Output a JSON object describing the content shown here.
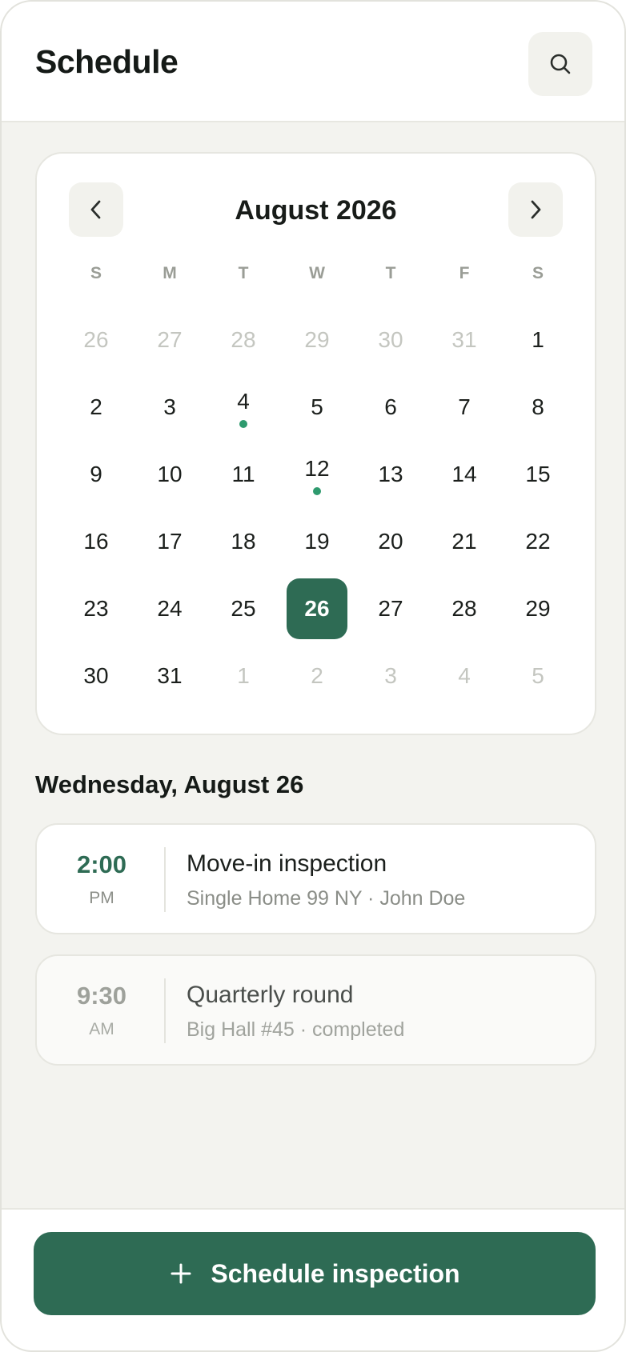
{
  "header": {
    "title": "Schedule"
  },
  "calendar": {
    "month": "August 2026",
    "weekdays": [
      "S",
      "M",
      "T",
      "W",
      "T",
      "F",
      "S"
    ],
    "days": [
      {
        "d": "26",
        "muted": true
      },
      {
        "d": "27",
        "muted": true
      },
      {
        "d": "28",
        "muted": true
      },
      {
        "d": "29",
        "muted": true
      },
      {
        "d": "30",
        "muted": true
      },
      {
        "d": "31",
        "muted": true
      },
      {
        "d": "1"
      },
      {
        "d": "2"
      },
      {
        "d": "3"
      },
      {
        "d": "4",
        "event": true
      },
      {
        "d": "5"
      },
      {
        "d": "6"
      },
      {
        "d": "7"
      },
      {
        "d": "8"
      },
      {
        "d": "9"
      },
      {
        "d": "10"
      },
      {
        "d": "11"
      },
      {
        "d": "12",
        "event": true
      },
      {
        "d": "13"
      },
      {
        "d": "14"
      },
      {
        "d": "15"
      },
      {
        "d": "16"
      },
      {
        "d": "17"
      },
      {
        "d": "18"
      },
      {
        "d": "19"
      },
      {
        "d": "20"
      },
      {
        "d": "21"
      },
      {
        "d": "22"
      },
      {
        "d": "23"
      },
      {
        "d": "24"
      },
      {
        "d": "25"
      },
      {
        "d": "26",
        "selected": true
      },
      {
        "d": "27"
      },
      {
        "d": "28"
      },
      {
        "d": "29"
      },
      {
        "d": "30"
      },
      {
        "d": "31"
      },
      {
        "d": "1",
        "muted": true
      },
      {
        "d": "2",
        "muted": true
      },
      {
        "d": "3",
        "muted": true
      },
      {
        "d": "4",
        "muted": true
      },
      {
        "d": "5",
        "muted": true
      }
    ]
  },
  "agenda": {
    "date_heading": "Wednesday, August 26",
    "events": [
      {
        "time": "2:00",
        "ampm": "PM",
        "title": "Move-in inspection",
        "subtitle": "Single Home 99 NY · John Doe",
        "completed": false
      },
      {
        "time": "9:30",
        "ampm": "AM",
        "title": "Quarterly round",
        "subtitle": "Big Hall #45 · completed",
        "completed": true
      }
    ]
  },
  "footer": {
    "cta_label": "Schedule inspection"
  },
  "colors": {
    "accent": "#2e6b54",
    "event_dot": "#2e9a6e",
    "background": "#f3f3ef"
  },
  "icons": {
    "search": "search-icon",
    "prev": "chevron-left-icon",
    "next": "chevron-right-icon",
    "add": "plus-icon"
  }
}
